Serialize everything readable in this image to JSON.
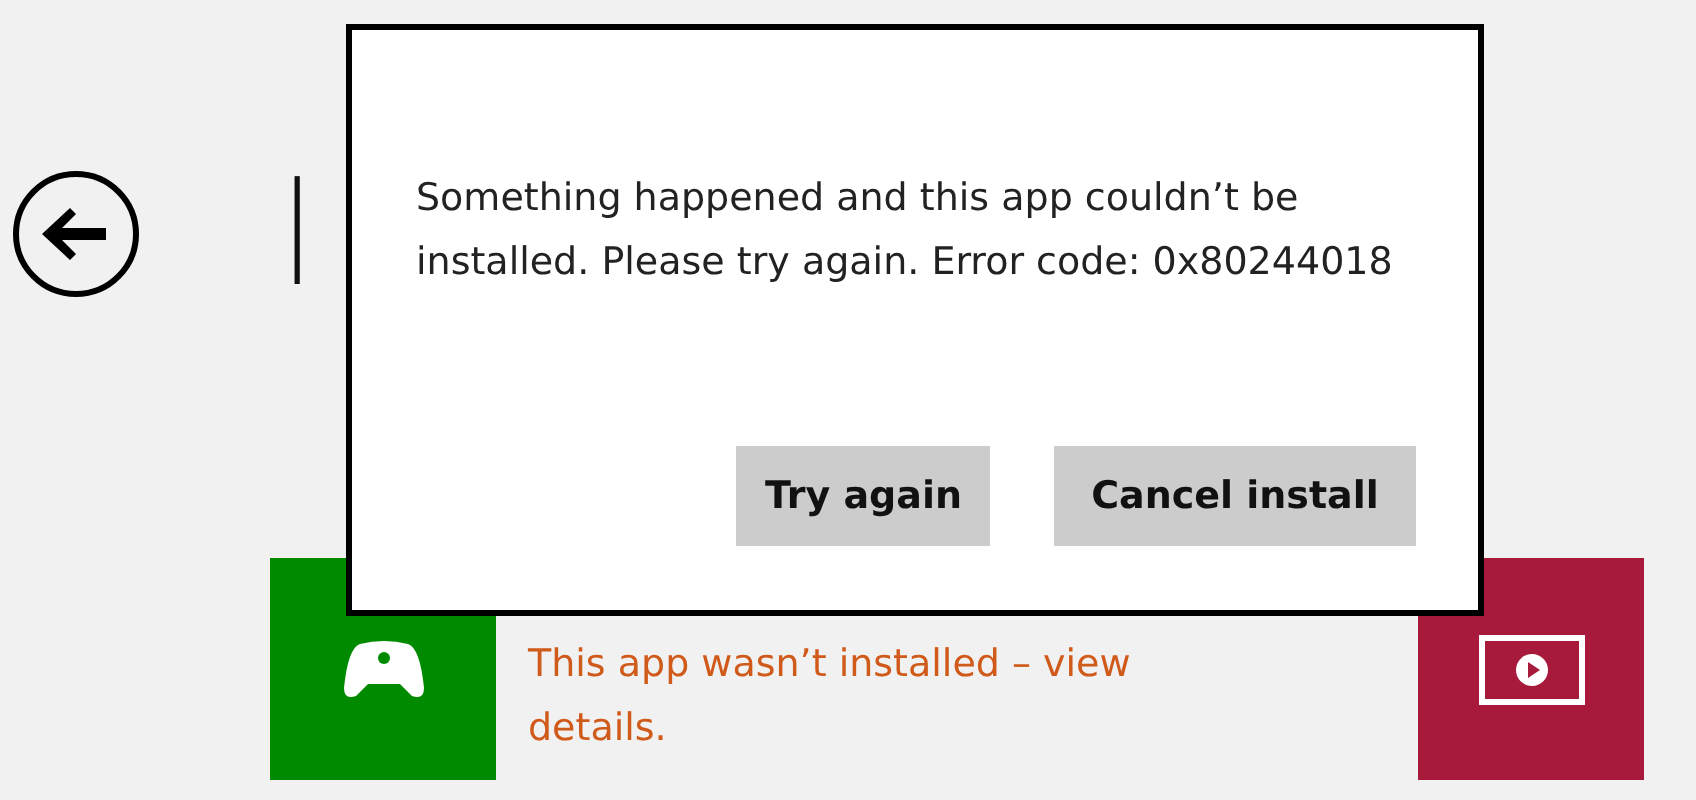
{
  "page_title": "I",
  "dialog": {
    "message": "Something happened and this app couldn’t be installed. Please try again. Error code: 0x80244018",
    "buttons": [
      {
        "label": "Try again"
      },
      {
        "label": "Cancel install"
      }
    ]
  },
  "status_row": {
    "tiles": [
      {
        "kind": "game",
        "color": "#008a00"
      },
      {
        "kind": "video",
        "color": "#a81a3c"
      }
    ],
    "message": "This app wasn’t installed – view details."
  }
}
